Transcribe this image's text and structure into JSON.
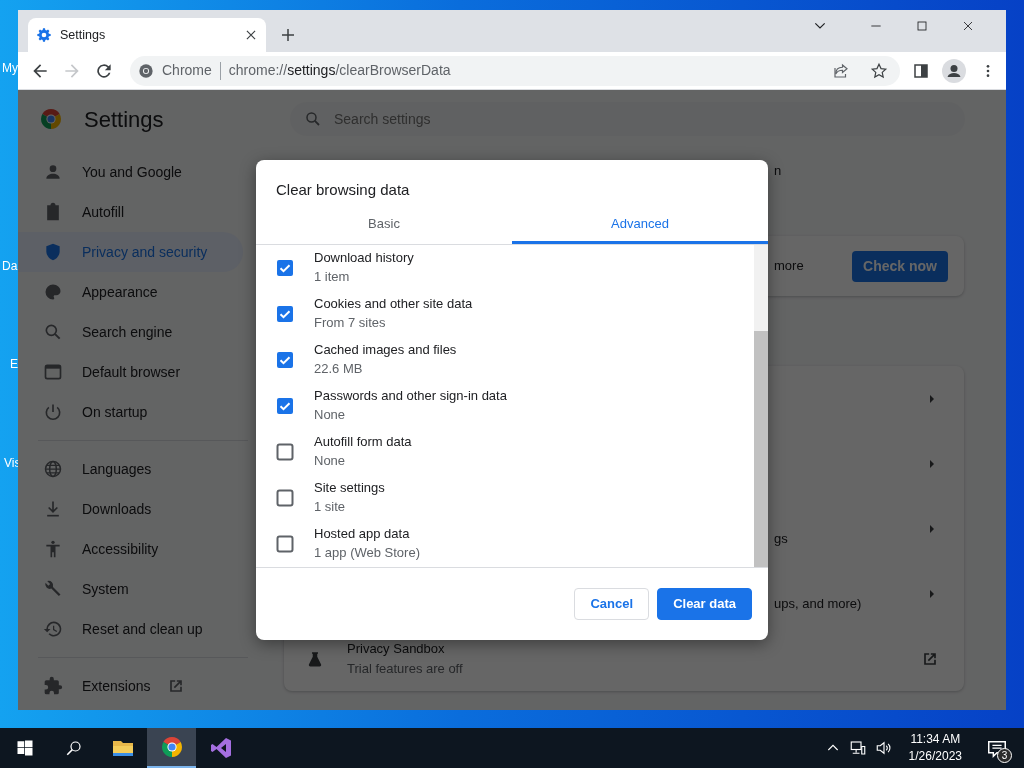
{
  "desktop_icons": [
    {
      "label": "My"
    },
    {
      "label": "Da"
    },
    {
      "label": "E"
    },
    {
      "label": "Vis"
    }
  ],
  "browser": {
    "tabs": [
      {
        "title": "Settings",
        "selected": true
      }
    ],
    "nav_buttons": [
      {
        "kind": "back",
        "disabled": false
      },
      {
        "kind": "forward",
        "disabled": true
      },
      {
        "kind": "reload",
        "disabled": false
      }
    ],
    "omnibox": {
      "chip": "Chrome",
      "url_scheme": "chrome://",
      "url_host": "settings",
      "url_path": "/clearBrowserData"
    }
  },
  "settings": {
    "title": "Settings",
    "search": {
      "placeholder": "Search settings"
    },
    "sidebar": [
      [
        {
          "label": "You and Google",
          "selected": false,
          "external": false
        },
        {
          "label": "Autofill",
          "selected": false,
          "external": false
        },
        {
          "label": "Privacy and security",
          "selected": true,
          "external": false
        },
        {
          "label": "Appearance",
          "selected": false,
          "external": false
        },
        {
          "label": "Search engine",
          "selected": false,
          "external": false
        },
        {
          "label": "Default browser",
          "selected": false,
          "external": false
        },
        {
          "label": "On startup",
          "selected": false,
          "external": false
        }
      ],
      [
        {
          "label": "Languages",
          "selected": false,
          "external": false
        },
        {
          "label": "Downloads",
          "selected": false,
          "external": false
        },
        {
          "label": "Accessibility",
          "selected": false,
          "external": false
        },
        {
          "label": "System",
          "selected": false,
          "external": false
        },
        {
          "label": "Reset and clean up",
          "selected": false,
          "external": false
        }
      ],
      [
        {
          "label": "Extensions",
          "selected": false,
          "external": true
        }
      ]
    ],
    "heading_fragment": "n",
    "safety_card": {
      "text": "more",
      "button": "Check now"
    },
    "rows": [
      {
        "kind": "arrow"
      },
      {
        "kind": "arrow"
      },
      {
        "kind": "arrow",
        "text": "gs"
      },
      {
        "kind": "arrow",
        "text": "ups, and more)"
      },
      {
        "kind": "external",
        "title": "Privacy Sandbox",
        "subtitle": "Trial features are off"
      }
    ]
  },
  "dialog": {
    "title": "Clear browsing data",
    "tabs": [
      {
        "label": "Basic",
        "selected": false
      },
      {
        "label": "Advanced",
        "selected": true
      }
    ],
    "items": [
      {
        "title": "Download history",
        "detail": "1 item",
        "checked": true
      },
      {
        "title": "Cookies and other site data",
        "detail": "From 7 sites",
        "checked": true
      },
      {
        "title": "Cached images and files",
        "detail": "22.6 MB",
        "checked": true
      },
      {
        "title": "Passwords and other sign-in data",
        "detail": "None",
        "checked": true
      },
      {
        "title": "Autofill form data",
        "detail": "None",
        "checked": false
      },
      {
        "title": "Site settings",
        "detail": "1 site",
        "checked": false
      },
      {
        "title": "Hosted app data",
        "detail": "1 app (Web Store)",
        "checked": false
      }
    ],
    "buttons": [
      {
        "label": "Cancel",
        "kind": "secondary"
      },
      {
        "label": "Clear data",
        "kind": "primary"
      }
    ]
  },
  "taskbar": {
    "apps": [
      {
        "kind": "folder",
        "selected": false
      },
      {
        "kind": "chrome",
        "selected": true
      },
      {
        "kind": "studio",
        "selected": false
      }
    ],
    "time": "11:34 AM",
    "date": "1/26/2023",
    "notifications": "3"
  }
}
